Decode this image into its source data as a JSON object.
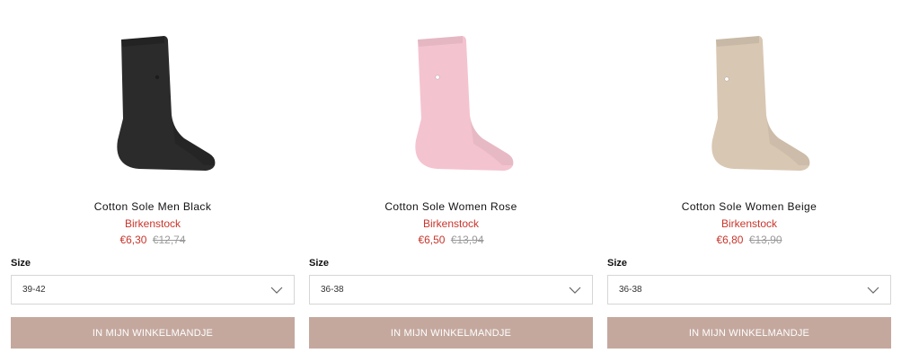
{
  "products": [
    {
      "name": "Cotton Sole Men Black",
      "brand": "Birkenstock",
      "price": "€6,30",
      "old_price": "€12,74",
      "size_label": "Size",
      "size_value": "39-42",
      "cart_label": "IN MIJN WINKELMANDJE",
      "sock_color": "#2b2b2b"
    },
    {
      "name": "Cotton Sole Women Rose",
      "brand": "Birkenstock",
      "price": "€6,50",
      "old_price": "€13,94",
      "size_label": "Size",
      "size_value": "36-38",
      "cart_label": "IN MIJN WINKELMANDJE",
      "sock_color": "#f4c3d0"
    },
    {
      "name": "Cotton Sole Women Beige",
      "brand": "Birkenstock",
      "price": "€6,80",
      "old_price": "€13,90",
      "size_label": "Size",
      "size_value": "36-38",
      "cart_label": "IN MIJN WINKELMANDJE",
      "sock_color": "#d8c7b3"
    }
  ],
  "colors": {
    "brand_red": "#c8352b",
    "button_bg": "#c4a89e",
    "strike_grey": "#9a9a9a"
  }
}
